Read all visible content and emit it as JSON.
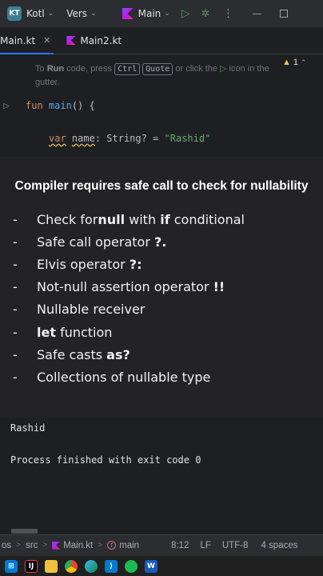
{
  "titlebar": {
    "project_badge": "KT",
    "project_name": "Kotl",
    "vcs_label": "Vers",
    "run_config": "Main"
  },
  "tabs": [
    {
      "label": "Main.kt",
      "active": true
    },
    {
      "label": "Main2.kt",
      "active": false
    }
  ],
  "editor": {
    "warning_count": "1",
    "hint": {
      "prefix": "To ",
      "run_word": "Run",
      "middle": " code, press ",
      "key1": "Ctrl",
      "key2": "Quote",
      "suffix": " or click the ",
      "icon_name": "run-gutter-icon",
      "tail": " icon in the",
      "tail2": "gutter."
    },
    "line1": {
      "kw": "fun",
      "name": "main",
      "rest": "() {"
    },
    "line2": {
      "kw": "var",
      "ident": "name",
      "type": ": String? = ",
      "value": "\"Rashid\""
    }
  },
  "overlay": {
    "title": "Compiler requires safe call to check for nullability",
    "items": [
      {
        "dash": "-",
        "parts": [
          "Check for ",
          "null",
          " with ",
          "if",
          " conditional"
        ]
      },
      {
        "dash": "-",
        "parts": [
          "Safe call operator ",
          "?."
        ]
      },
      {
        "dash": "-",
        "parts": [
          "Elvis operator ",
          "?:"
        ]
      },
      {
        "dash": "-",
        "parts": [
          "Not-null assertion operator ",
          "!!"
        ]
      },
      {
        "dash": "-",
        "parts": [
          "Nullable receiver"
        ]
      },
      {
        "dash": "-",
        "parts": [
          "",
          "let",
          " function"
        ]
      },
      {
        "dash": "-",
        "parts": [
          "Safe casts ",
          "as?"
        ]
      },
      {
        "dash": "-",
        "parts": [
          "Collections of nullable type"
        ]
      }
    ]
  },
  "output": {
    "line1": "Rashid",
    "line2": "Process finished with exit code 0"
  },
  "statusbar": {
    "crumb1": "os",
    "crumb2": "src",
    "crumb3": "Main.kt",
    "crumb4": "main",
    "position": "8:12",
    "line_sep": "LF",
    "encoding": "UTF-8",
    "indent": "4 spaces"
  },
  "taskbar": {
    "apps": [
      "windows-start-icon",
      "intellij-icon",
      "file-explorer-icon",
      "chrome-icon",
      "edge-icon",
      "vscode-icon",
      "spotify-icon",
      "word-icon"
    ]
  },
  "colors": {
    "accent": "#3574f0",
    "run_green": "#57965c",
    "keyword": "#cf8e6d",
    "function": "#56a8f5",
    "string": "#6aab73"
  }
}
